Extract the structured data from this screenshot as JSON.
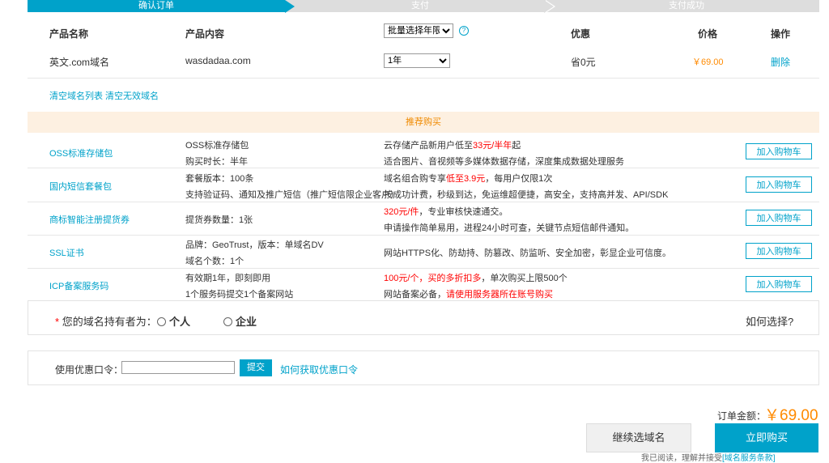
{
  "steps": [
    "确认订单",
    "支付",
    "支付成功"
  ],
  "table": {
    "headers": {
      "name": "产品名称",
      "content": "产品内容",
      "year_select": "批量选择年限",
      "discount": "优惠",
      "price": "价格",
      "action": "操作"
    },
    "row": {
      "name": "英文.com域名",
      "content": "wasdadaa.com",
      "year": "1年",
      "discount": "省0元",
      "price": "￥69.00",
      "action": "删除"
    }
  },
  "links": {
    "clear_list": "清空域名列表",
    "clear_invalid": "清空无效域名"
  },
  "recommend": {
    "title": "推荐购买",
    "button_label": "加入购物车",
    "items": [
      {
        "name": "OSS标准存储包",
        "c1": "OSS标准存储包",
        "c2": "购买时长：半年",
        "d1a": "云存储产品新用户低至",
        "d1b": "33元/半年",
        "d1c": "起",
        "d2": "适合图片、音视频等多媒体数据存储，深度集成数据处理服务"
      },
      {
        "name": "国内短信套餐包",
        "c1": "套餐版本：100条",
        "c2": "支持验证码、通知及推广短信（推广短信限企业客户）",
        "d1a": "域名组合购专享",
        "d1b": "低至3.9元",
        "d1c": "，每用户仅限1次",
        "d2": "按成功计费，秒级到达，免运维超便捷，高安全，支持高并发、API/SDK"
      },
      {
        "name": "商标智能注册提货券",
        "c1": "提货券数量：1张",
        "d1": "320元/件",
        "d1c": "，专业审核快速通交。",
        "d2": "申请操作简单易用，进程24小时可查，关键节点短信邮件通知。"
      },
      {
        "name": "SSL证书",
        "c1": "品牌：GeoTrust，版本：单域名DV",
        "c2": "域名个数：1个",
        "d1": "网站HTTPS化、防劫持、防篡改、防监听、安全加密，彰显企业可信度。"
      },
      {
        "name": "ICP备案服务码",
        "c1": "有效期1年，即刻即用",
        "c2": "1个服务码提交1个备案网站",
        "d1a": "100元/个，买的多折扣多",
        "d1c": "，单次购买上限500个",
        "d2a": "网站备案必备，",
        "d2b": "请使用服务器所在账号购买"
      }
    ]
  },
  "holder": {
    "star": "*",
    "label": "您的域名持有者为：",
    "personal": "个人",
    "company": "企业",
    "how": "如何选择?"
  },
  "coupon": {
    "label": "使用优惠口令：",
    "value": "",
    "submit": "提交",
    "how": "如何获取优惠口令"
  },
  "order": {
    "total_label": "订单金额：",
    "total": "￥69.00",
    "continue": "继续选域名",
    "buy": "立即购买",
    "agree_prefix": "我已阅读，理解并接受",
    "agree_link": "[域名服务条款]"
  },
  "colors": {
    "accent": "#00a2ca",
    "price": "#ff8a00",
    "warn": "#ff0000"
  }
}
